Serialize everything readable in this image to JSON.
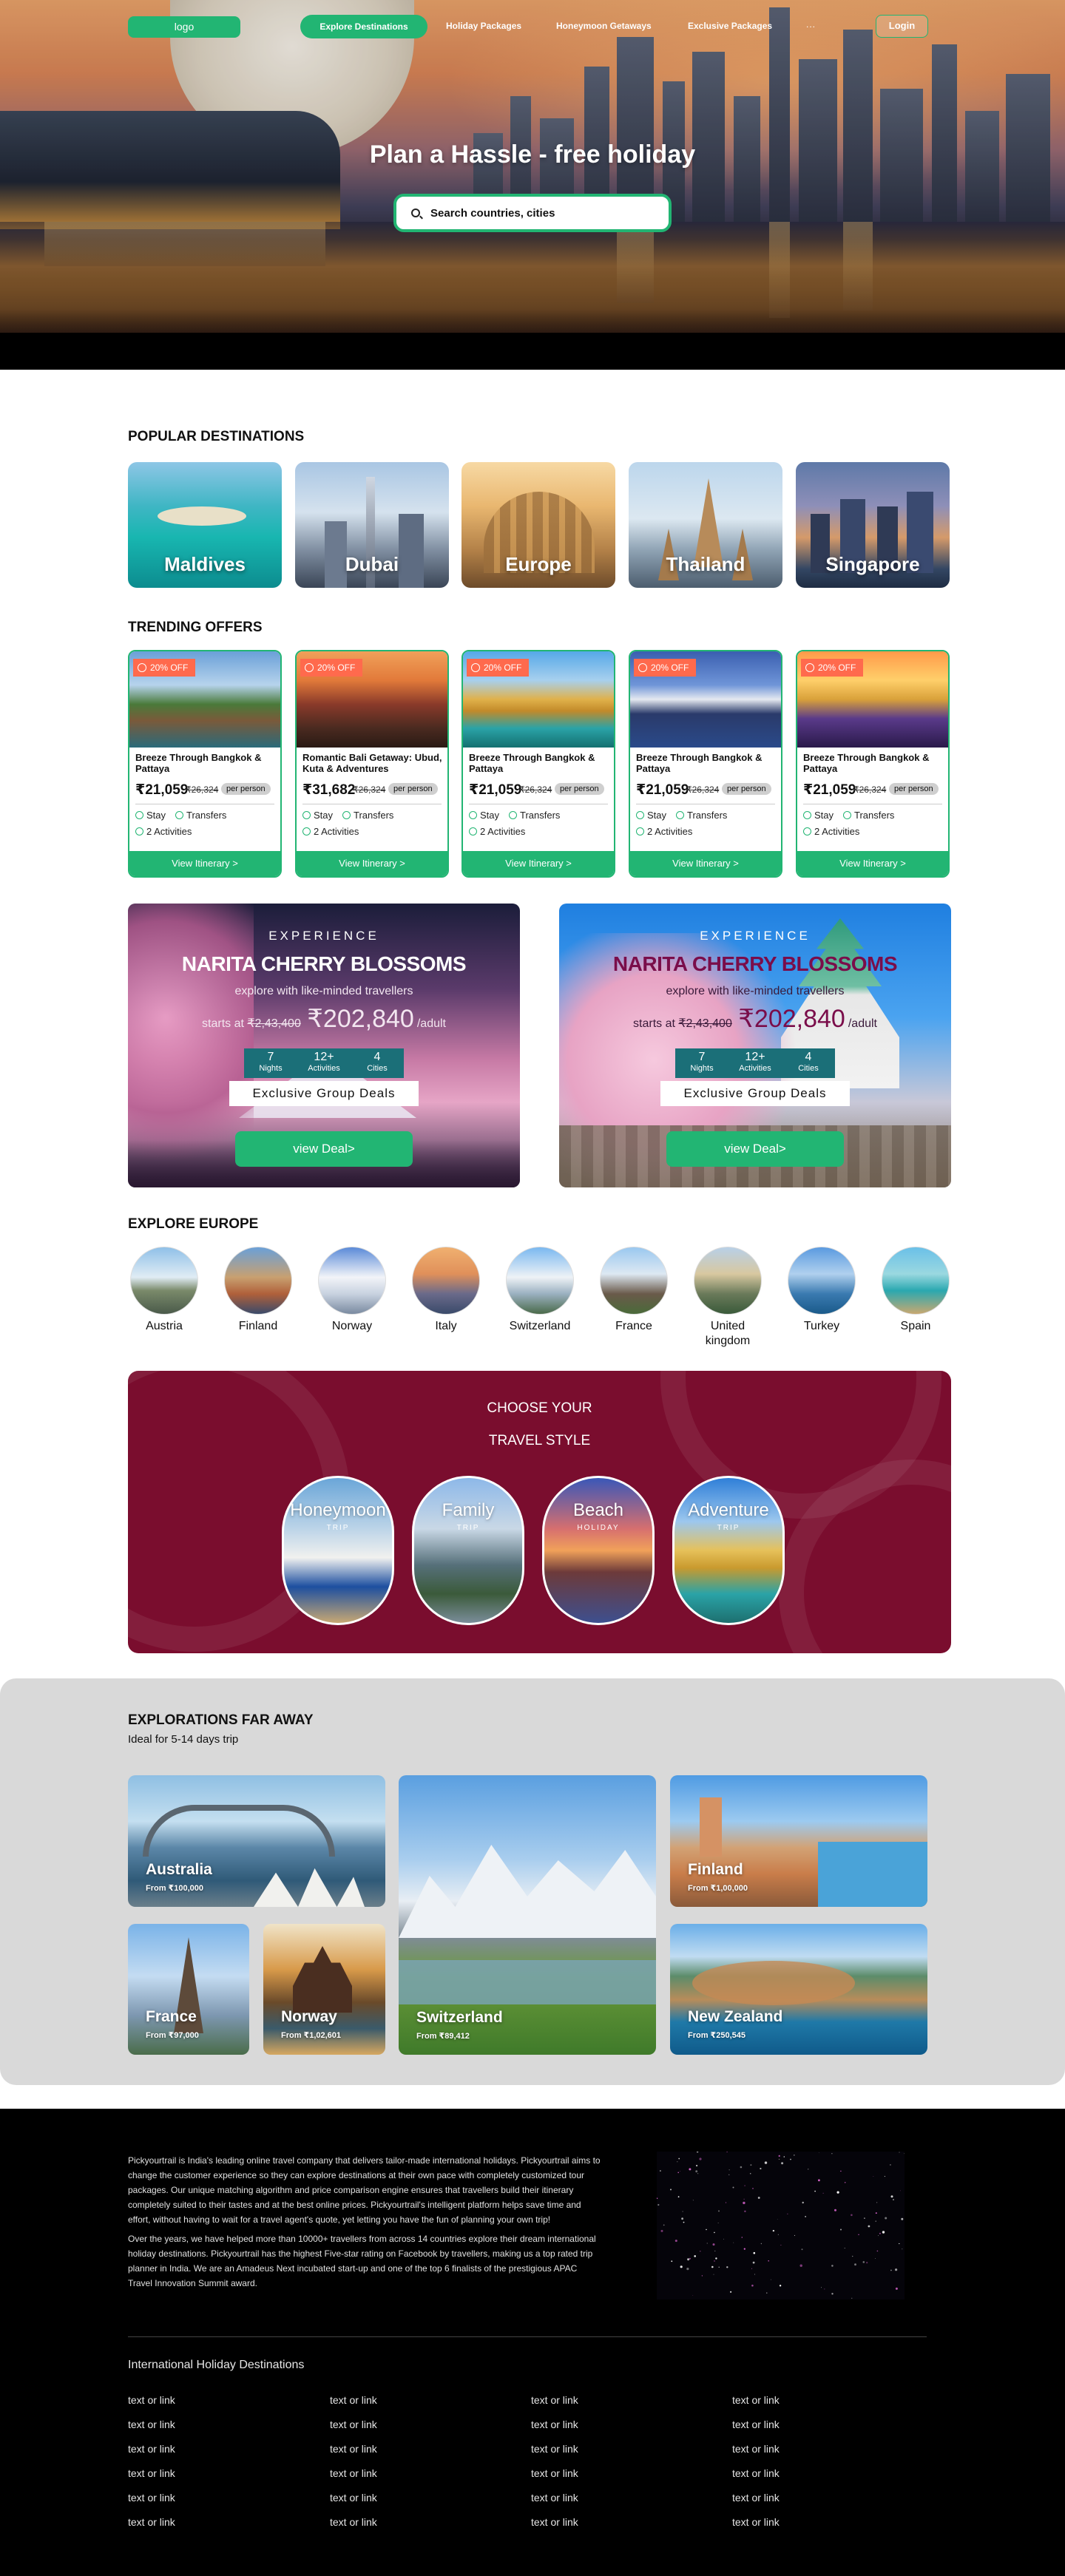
{
  "header": {
    "logo": "logo",
    "nav": [
      "Explore Destinations",
      "Holiday Packages",
      "Honeymoon Getaways",
      "Exclusive Packages"
    ],
    "more": "...",
    "login": "Login"
  },
  "hero": {
    "title": "Plan a Hassle - free holiday",
    "search_placeholder": "Search countries, cities"
  },
  "popular": {
    "title": "POPULAR DESTINATIONS",
    "items": [
      "Maldives",
      "Dubai",
      "Europe",
      "Thailand",
      "Singapore"
    ]
  },
  "trending": {
    "title": "TRENDING OFFERS",
    "per_person": "per person",
    "button": "View Itinerary >",
    "items": [
      {
        "badge": "20% OFF",
        "title": "Breeze Through Bangkok & Pattaya",
        "price": "₹21,059",
        "old": "₹26,324",
        "features": [
          "Stay",
          "Transfers",
          "2 Activities"
        ]
      },
      {
        "badge": "20% OFF",
        "title": "Romantic Bali Getaway: Ubud, Kuta & Adventures",
        "price": "₹31,682",
        "old": "₹26,324",
        "features": [
          "Stay",
          "Transfers",
          "2 Activities"
        ]
      },
      {
        "badge": "20% OFF",
        "title": "Breeze Through Bangkok & Pattaya",
        "price": "₹21,059",
        "old": "₹26,324",
        "features": [
          "Stay",
          "Transfers",
          "2 Activities"
        ]
      },
      {
        "badge": "20% OFF",
        "title": "Breeze Through Bangkok & Pattaya",
        "price": "₹21,059",
        "old": "₹26,324",
        "features": [
          "Stay",
          "Transfers",
          "2 Activities"
        ]
      },
      {
        "badge": "20% OFF",
        "title": "Breeze Through Bangkok & Pattaya",
        "price": "₹21,059",
        "old": "₹26,324",
        "features": [
          "Stay",
          "Transfers",
          "2 Activities"
        ]
      }
    ]
  },
  "experience": [
    {
      "kicker": "EXPERIENCE",
      "title": "NARITA CHERRY BLOSSOMS",
      "subtitle": "explore with like-minded travellers",
      "from": "starts at",
      "old_price": "₹2,43,400",
      "price": "₹202,840",
      "unit": "/adult",
      "stats": [
        {
          "n": "7",
          "l": "Nights"
        },
        {
          "n": "12+",
          "l": "Activities"
        },
        {
          "n": "4",
          "l": "Cities"
        }
      ],
      "deal": "Exclusive Group Deals",
      "button": "view Deal>"
    },
    {
      "kicker": "EXPERIENCE",
      "title": "NARITA CHERRY BLOSSOMS",
      "subtitle": "explore with like-minded travellers",
      "from": "starts at",
      "old_price": "₹2,43,400",
      "price": "₹202,840",
      "unit": "/adult",
      "stats": [
        {
          "n": "7",
          "l": "Nights"
        },
        {
          "n": "12+",
          "l": "Activities"
        },
        {
          "n": "4",
          "l": "Cities"
        }
      ],
      "deal": "Exclusive Group Deals",
      "button": "view Deal>"
    }
  ],
  "europe": {
    "title": "EXPLORE EUROPE",
    "items": [
      "Austria",
      "Finland",
      "Norway",
      "Italy",
      "Switzerland",
      "France",
      "United kingdom",
      "Turkey",
      "Spain"
    ]
  },
  "style": {
    "title_line1": "CHOOSE YOUR",
    "title_line2": "TRAVEL STYLE",
    "items": [
      {
        "name": "Honeymoon",
        "sub": "TRIP"
      },
      {
        "name": "Family",
        "sub": "TRIP"
      },
      {
        "name": "Beach",
        "sub": "HOLIDAY"
      },
      {
        "name": "Adventure",
        "sub": "TRIP"
      }
    ]
  },
  "far": {
    "title": "EXPLORATIONS FAR AWAY",
    "subtitle": "Ideal for  5-14 days trip",
    "items": [
      {
        "name": "Australia",
        "price": "From ₹100,000"
      },
      {
        "name": "Switzerland",
        "price": "From ₹89,412"
      },
      {
        "name": "Finland",
        "price": "From ₹1,00,000"
      },
      {
        "name": "France",
        "price": "From ₹97,000"
      },
      {
        "name": "Norway",
        "price": "From ₹1,02,601"
      },
      {
        "name": "New Zealand",
        "price": "From ₹250,545"
      }
    ]
  },
  "footer": {
    "about_1": "Pickyourtrail is India's leading online travel company that delivers tailor-made international holidays. Pickyourtrail aims to change the customer experience so they can explore destinations at their own pace with completely customized tour packages. Our unique matching algorithm and price comparison engine ensures that travellers build their itinerary completely suited to their tastes and at the best online prices. Pickyourtrail's intelligent platform helps save time and effort, without having to wait for a travel agent's quote, yet letting you have the fun of planning your own trip!",
    "about_2": "Over the years, we have helped more than 10000+ travellers from across 14 countries explore their dream international holiday destinations. Pickyourtrail has the highest Five-star rating on Facebook by travellers, making us a top rated trip planner in India. We are an Amadeus Next incubated start-up and one of the top 6 finalists of the prestigious APAC Travel Innovation Summit award.",
    "links_title": "International Holiday Destinations",
    "links": [
      [
        "text or link",
        "text or link",
        "text or link",
        "text or link",
        "text or link",
        "text or link"
      ],
      [
        "text or link",
        "text or link",
        "text or link",
        "text or link",
        "text or link",
        "text or link"
      ],
      [
        "text or link",
        "text or link",
        "text or link",
        "text or link",
        "text or link",
        "text or link"
      ],
      [
        "text or link",
        "text or link",
        "text or link",
        "text or link",
        "text or link",
        "text or link"
      ]
    ]
  },
  "colors": {
    "brand": "#22b573",
    "style_bg": "#7a0d2e",
    "badge": "#ff6a4d",
    "stats_bg": "#1b6f78"
  }
}
